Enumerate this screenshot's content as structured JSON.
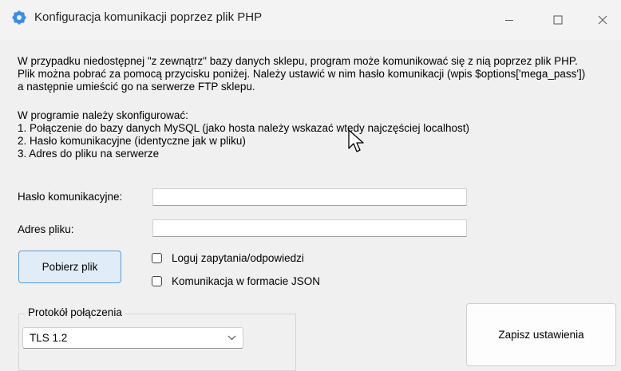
{
  "window": {
    "title": "Konfiguracja komunikacji poprzez plik PHP",
    "icon": "gear-icon",
    "controls": {
      "minimize": "minimize-icon",
      "maximize": "maximize-icon",
      "close": "close-icon"
    }
  },
  "description": {
    "line1": "W przypadku niedostępnej \"z zewnątrz\" bazy danych sklepu, program może komunikować się z nią poprzez plik PHP.",
    "line2": "Plik można pobrać za pomocą przycisku poniżej. Należy ustawić w nim hasło komunikacji (wpis $options['mega_pass'])",
    "line3": "a następnie umieścić go na serwerze FTP sklepu.",
    "steps_header": "W programie należy skonfigurować:",
    "step1": "1. Połączenie do bazy danych MySQL (jako hosta należy wskazać wtedy najczęściej localhost)",
    "step2": "2. Hasło komunikacyjne (identyczne jak w pliku)",
    "step3": "3. Adres do pliku na serwerze"
  },
  "form": {
    "password_label": "Hasło komunikacyjne:",
    "password_value": "",
    "url_label": "Adres pliku:",
    "url_value": ""
  },
  "buttons": {
    "download": "Pobierz plik",
    "save": "Zapisz ustawienia"
  },
  "options": {
    "log_label": "Loguj zapytania/odpowiedzi",
    "log_checked": false,
    "json_label": "Komunikacja w formacie JSON",
    "json_checked": false
  },
  "protocol": {
    "legend": "Protokół połączenia",
    "selected": "TLS 1.2"
  }
}
